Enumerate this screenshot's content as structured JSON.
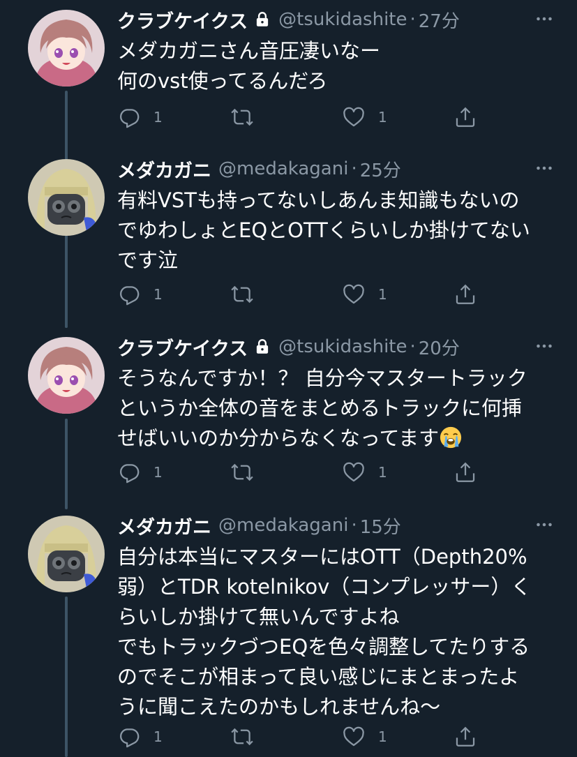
{
  "tweets": [
    {
      "name": "クラブケイクス",
      "locked": true,
      "handle": "@tsukidashite",
      "dot": "·",
      "time": "27分",
      "lines": [
        "メダカガニさん音圧凄いなー",
        "何のvst使ってるんだろ"
      ],
      "reply_count": "1",
      "retweet_count": "",
      "like_count": "1",
      "avatar": "pink-hair-anime-girl"
    },
    {
      "name": "メダカガニ",
      "locked": false,
      "handle": "@medakagani",
      "dot": "·",
      "time": "25分",
      "lines": [
        "有料VSTも持ってないしあんま知識もないの",
        "でゆわしょとEQとOTTくらいしか掛けてない",
        "です泣"
      ],
      "reply_count": "1",
      "retweet_count": "",
      "like_count": "1",
      "avatar": "blonde-bob-character"
    },
    {
      "name": "クラブケイクス",
      "locked": true,
      "handle": "@tsukidashite",
      "dot": "·",
      "time": "20分",
      "lines": [
        "そうなんですか！？ 自分今マスタートラック",
        "というか全体の音をまとめるトラックに何挿",
        "せばいいのか分からなくなってます"
      ],
      "emoji": "loudly-crying-face",
      "reply_count": "1",
      "retweet_count": "",
      "like_count": "1",
      "avatar": "pink-hair-anime-girl"
    },
    {
      "name": "メダカガニ",
      "locked": false,
      "handle": "@medakagani",
      "dot": "·",
      "time": "15分",
      "lines": [
        "自分は本当にマスターにはOTT（Depth20%",
        "弱）とTDR kotelnikov（コンプレッサー）く",
        "らいしか掛けて無いんですよね",
        "でもトラックづつEQを色々調整してたりする",
        "のでそこが相まって良い感じにまとまったよ",
        "うに聞こえたのかもしれませんね〜"
      ],
      "reply_count": "1",
      "retweet_count": "",
      "like_count": "1",
      "avatar": "blonde-bob-character"
    }
  ],
  "colors": {
    "background": "#15202b",
    "text": "#ffffff",
    "muted": "#8b98a5",
    "thread_line": "#3d5466"
  }
}
